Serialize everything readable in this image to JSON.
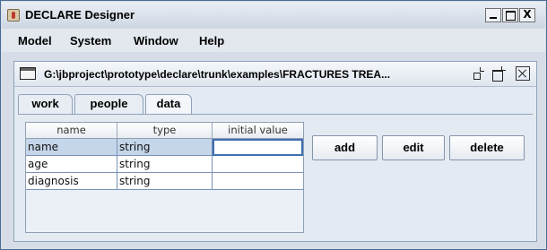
{
  "app": {
    "title": "DECLARE Designer"
  },
  "menubar": {
    "items": [
      "Model",
      "System",
      "Window",
      "Help"
    ]
  },
  "internal_frame": {
    "title": "G:\\jbproject\\prototype\\declare\\trunk\\examples\\FRACTURES TREA..."
  },
  "tabs": [
    {
      "label": "work",
      "selected": false
    },
    {
      "label": "people",
      "selected": false
    },
    {
      "label": "data",
      "selected": true
    }
  ],
  "table": {
    "columns": [
      "name",
      "type",
      "initial value"
    ],
    "rows": [
      {
        "name": "name",
        "type": "string",
        "initial": ""
      },
      {
        "name": "age",
        "type": "string",
        "initial": ""
      },
      {
        "name": "diagnosis",
        "type": "string",
        "initial": ""
      }
    ],
    "selected_row": 0
  },
  "buttons": {
    "add": "add",
    "edit": "edit",
    "delete": "delete"
  },
  "window_controls": {
    "close_glyph": "X"
  },
  "colors": {
    "selection": "#c5d6ea",
    "focus_border": "#3f6fb0",
    "frame_border": "#8ea3bd"
  }
}
